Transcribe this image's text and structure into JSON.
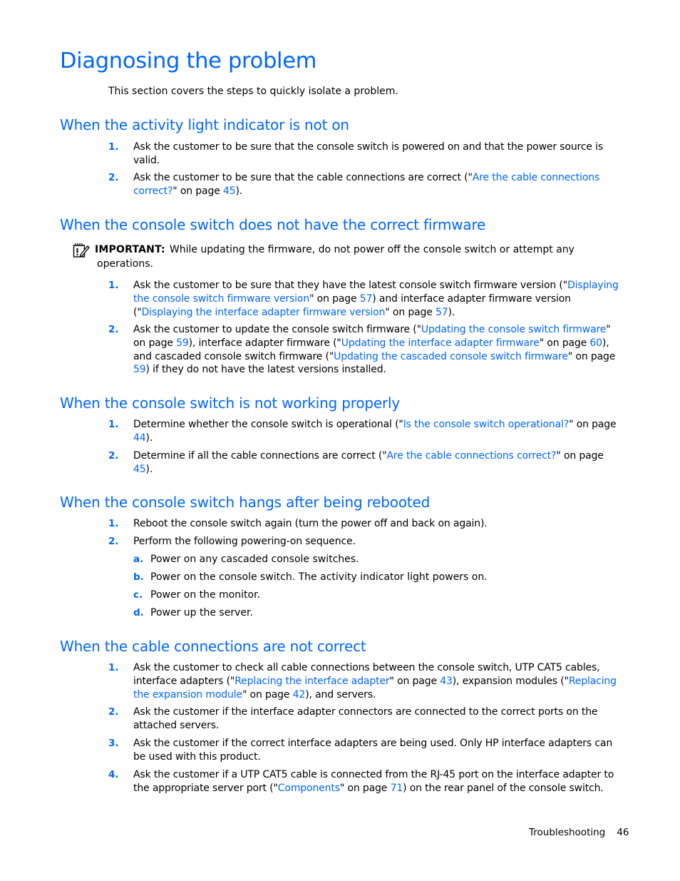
{
  "title": "Diagnosing the problem",
  "intro": "This section covers the steps to quickly isolate a problem.",
  "colors": {
    "accent": "#0066ff",
    "text": "#000000"
  },
  "sections": [
    {
      "heading": "When the activity light indicator is not on",
      "items": [
        {
          "num": "1.",
          "segments": [
            {
              "t": "Ask the customer to be sure that the console switch is powered on and that the power source is valid."
            }
          ]
        },
        {
          "num": "2.",
          "segments": [
            {
              "t": "Ask the customer to be sure that the cable connections are correct (\""
            },
            {
              "t": "Are the cable connections correct?",
              "link": true
            },
            {
              "t": "\" on page "
            },
            {
              "t": "45",
              "link": true
            },
            {
              "t": ")."
            }
          ]
        }
      ]
    },
    {
      "heading": "When the console switch does not have the correct firmware",
      "note": {
        "icon": "important-note-icon",
        "label": "IMPORTANT:",
        "line1": "While updating the firmware, do not power off the console switch or attempt any",
        "line2": "operations."
      },
      "items": [
        {
          "num": "1.",
          "segments": [
            {
              "t": "Ask the customer to be sure that they have the latest console switch firmware version (\""
            },
            {
              "t": "Displaying the console switch firmware version",
              "link": true
            },
            {
              "t": "\" on page "
            },
            {
              "t": "57",
              "link": true
            },
            {
              "t": ") and interface adapter firmware version (\""
            },
            {
              "t": "Displaying the interface adapter firmware version",
              "link": true
            },
            {
              "t": "\" on page "
            },
            {
              "t": "57",
              "link": true
            },
            {
              "t": ")."
            }
          ]
        },
        {
          "num": "2.",
          "segments": [
            {
              "t": "Ask the customer to update the console switch firmware (\""
            },
            {
              "t": "Updating the console switch firmware",
              "link": true
            },
            {
              "t": "\" on page "
            },
            {
              "t": "59",
              "link": true
            },
            {
              "t": "), interface adapter firmware (\""
            },
            {
              "t": "Updating the interface adapter firmware",
              "link": true
            },
            {
              "t": "\" on page "
            },
            {
              "t": "60",
              "link": true
            },
            {
              "t": "), and cascaded console switch firmware (\""
            },
            {
              "t": "Updating the cascaded console switch firmware",
              "link": true
            },
            {
              "t": "\" on page "
            },
            {
              "t": "59",
              "link": true
            },
            {
              "t": ") if they do not have the latest versions installed."
            }
          ]
        }
      ]
    },
    {
      "heading": "When the console switch is not working properly",
      "items": [
        {
          "num": "1.",
          "segments": [
            {
              "t": "Determine whether the console switch is operational (\""
            },
            {
              "t": "Is the console switch operational?",
              "link": true
            },
            {
              "t": "\" on page "
            },
            {
              "t": "44",
              "link": true
            },
            {
              "t": ")."
            }
          ]
        },
        {
          "num": "2.",
          "segments": [
            {
              "t": "Determine if all the cable connections are correct (\""
            },
            {
              "t": "Are the cable connections correct?",
              "link": true
            },
            {
              "t": "\" on page "
            },
            {
              "t": "45",
              "link": true
            },
            {
              "t": ")."
            }
          ]
        }
      ]
    },
    {
      "heading": "When the console switch hangs after being rebooted",
      "items": [
        {
          "num": "1.",
          "segments": [
            {
              "t": "Reboot the console switch again (turn the power off and back on again)."
            }
          ]
        },
        {
          "num": "2.",
          "segments": [
            {
              "t": "Perform the following powering-on sequence."
            }
          ]
        }
      ],
      "subitems": [
        {
          "num": "a.",
          "text": "Power on any cascaded console switches."
        },
        {
          "num": "b.",
          "text": "Power on the console switch. The activity indicator light powers on."
        },
        {
          "num": "c.",
          "text": "Power on the monitor."
        },
        {
          "num": "d.",
          "text": "Power up the server."
        }
      ]
    },
    {
      "heading": "When the cable connections are not correct",
      "items": [
        {
          "num": "1.",
          "segments": [
            {
              "t": "Ask the customer to check all cable connections between the console switch, UTP CAT5 cables, interface adapters (\""
            },
            {
              "t": "Replacing the interface adapter",
              "link": true
            },
            {
              "t": "\" on page "
            },
            {
              "t": "43",
              "link": true
            },
            {
              "t": "), expansion modules (\""
            },
            {
              "t": "Replacing the expansion module",
              "link": true
            },
            {
              "t": "\" on page "
            },
            {
              "t": "42",
              "link": true
            },
            {
              "t": "), and servers."
            }
          ]
        },
        {
          "num": "2.",
          "segments": [
            {
              "t": "Ask the customer if the interface adapter connectors are connected to the correct ports on the attached servers."
            }
          ]
        },
        {
          "num": "3.",
          "segments": [
            {
              "t": "Ask the customer if the correct interface adapters are being used. Only HP interface adapters can be used with this product."
            }
          ]
        },
        {
          "num": "4.",
          "segments": [
            {
              "t": "Ask the customer if a UTP CAT5 cable is connected from the RJ-45 port on the interface adapter to the appropriate server port (\""
            },
            {
              "t": "Components",
              "link": true
            },
            {
              "t": "\" on page "
            },
            {
              "t": "71",
              "link": true
            },
            {
              "t": ") on the rear panel of the console switch."
            }
          ]
        }
      ]
    }
  ],
  "footer": {
    "section": "Troubleshooting",
    "page": "46"
  }
}
